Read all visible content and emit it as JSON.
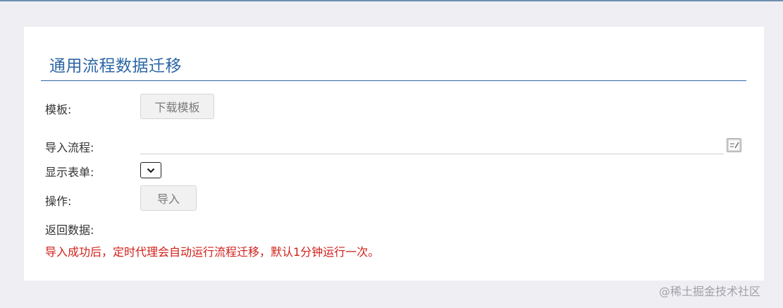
{
  "form": {
    "title": "通用流程数据迁移",
    "template_label": "模板:",
    "download_button": "下载模板",
    "import_flow_label": "导入流程:",
    "import_flow_value": "",
    "show_form_label": "显示表单:",
    "show_form_selected": "",
    "action_label": "操作:",
    "import_button": "导入",
    "return_data_label": "返回数据:",
    "notice": "导入成功后，定时代理会自动运行流程迁移，默认1分钟运行一次。"
  },
  "watermark": "@稀土掘金技术社区",
  "icons": {
    "picker": "edit-picker-icon",
    "dropdown": "chevron-down-icon"
  },
  "colors": {
    "title": "#2d67a6",
    "notice": "#d0201a",
    "background": "#efeff3"
  }
}
